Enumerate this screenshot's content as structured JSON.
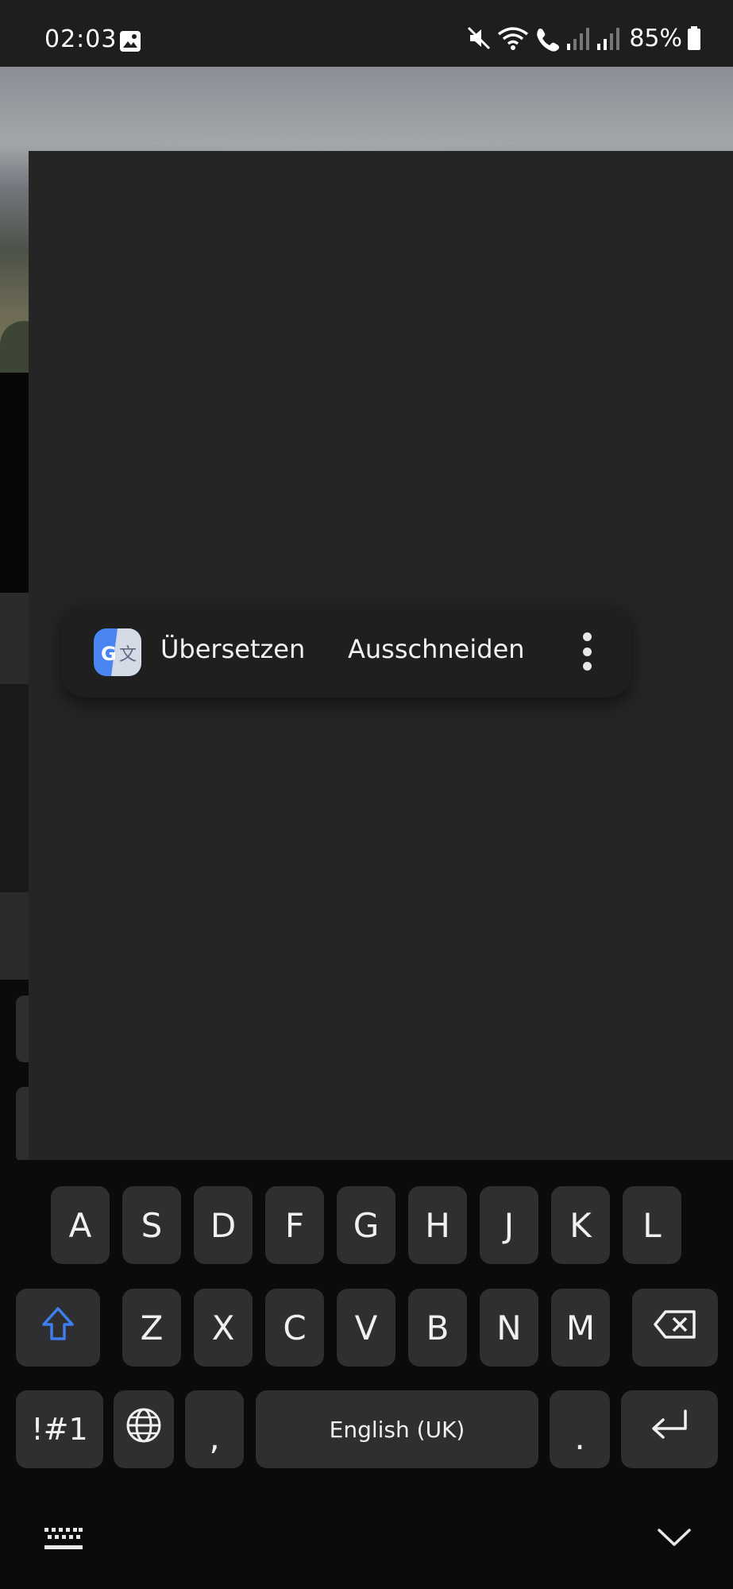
{
  "status_bar": {
    "time": "02:03",
    "battery": "85%",
    "icons": [
      "gallery-icon",
      "mute-icon",
      "wifi-icon",
      "wifi-call-icon",
      "signal-icon",
      "signal-icon",
      "battery-icon"
    ]
  },
  "context_menu": {
    "translate_label": "Übersetzen",
    "cut_label": "Ausschneiden",
    "more_icon": "more-vert-icon"
  },
  "keyboard": {
    "row2": [
      "A",
      "S",
      "D",
      "F",
      "G",
      "H",
      "J",
      "K",
      "L"
    ],
    "row3": [
      "Z",
      "X",
      "C",
      "V",
      "B",
      "N",
      "M"
    ],
    "symbols_label": "!#1",
    "comma_label": ",",
    "space_label": "English (UK)",
    "period_label": ".",
    "icons": {
      "shift": "shift-icon",
      "backspace": "backspace-icon",
      "globe": "globe-icon",
      "enter": "enter-icon",
      "keyboard_switch": "keyboard-icon",
      "hide": "chevron-down-icon"
    }
  },
  "colors": {
    "accent": "#3d7ff0",
    "overlay": "#252526",
    "key": "#2f2f31"
  }
}
